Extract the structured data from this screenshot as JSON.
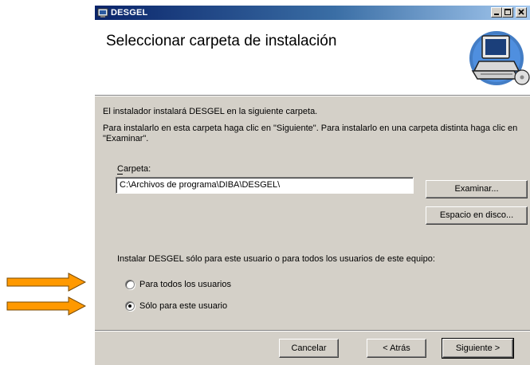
{
  "window": {
    "title": "DESGEL",
    "controls": [
      "minimize",
      "maximize",
      "close"
    ]
  },
  "header": {
    "title": "Seleccionar carpeta de instalación",
    "icon": "computer-install-icon"
  },
  "body": {
    "intro": "El instalador instalará DESGEL en la siguiente carpeta.",
    "instructions": "Para instalarlo en esta carpeta haga clic en \"Siguiente\". Para instalarlo en una carpeta distinta haga clic en \"Examinar\".",
    "folder_label": "Carpeta:",
    "folder_value": "C:\\Archivos de programa\\DIBA\\DESGEL\\",
    "browse_button": "Examinar...",
    "disk_space_button": "Espacio en disco...",
    "install_for_label": "Instalar DESGEL sólo para este usuario o para todos los usuarios de este equipo:",
    "options": [
      {
        "label": "Para todos los usuarios",
        "selected": false
      },
      {
        "label": "Sólo para este usuario",
        "selected": true
      }
    ]
  },
  "footer": {
    "cancel": "Cancelar",
    "back": "< Atrás",
    "next": "Siguiente >"
  },
  "annotations": {
    "arrow_color": "#ff9900",
    "arrows": [
      "arrow-right-icon",
      "arrow-right-icon"
    ]
  }
}
